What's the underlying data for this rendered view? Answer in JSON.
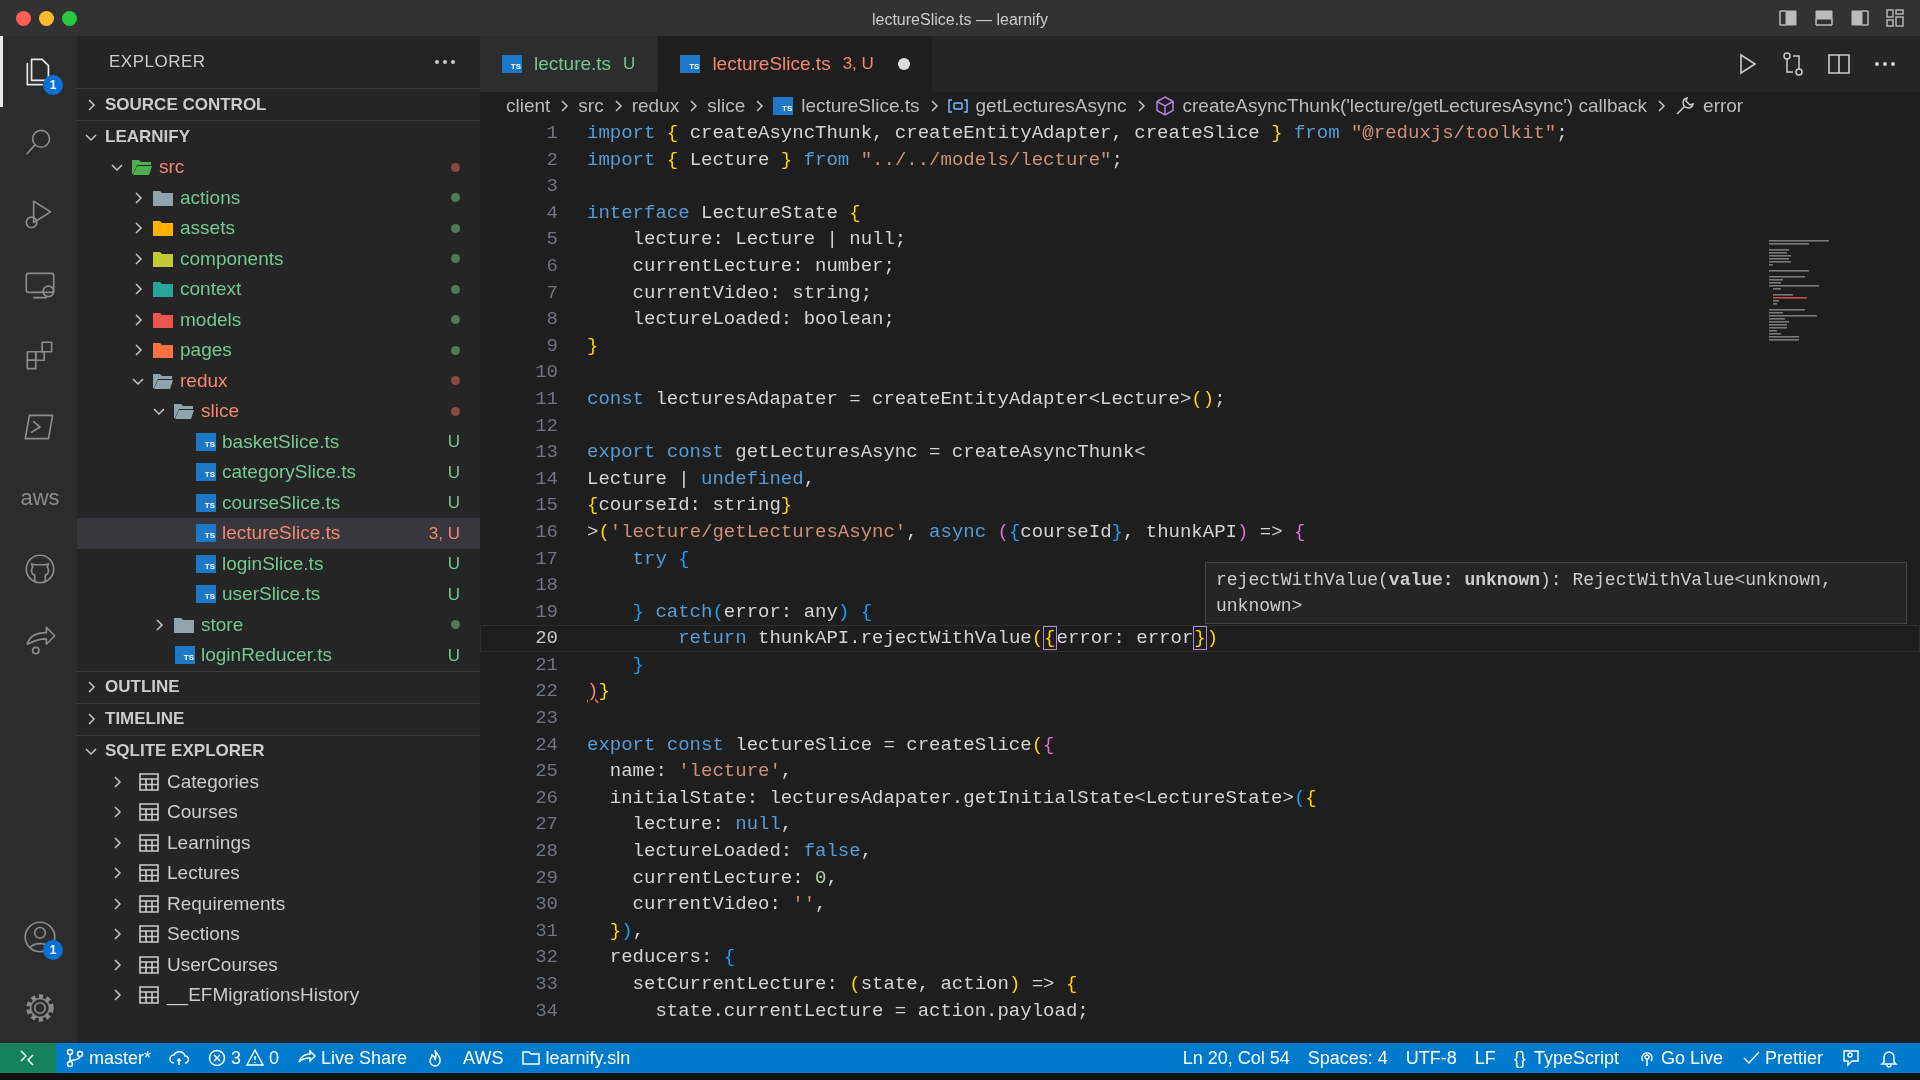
{
  "window": {
    "title": "lectureSlice.ts — learnify"
  },
  "activity_bar": [
    {
      "kind": "files",
      "selected": true,
      "badge": "1"
    },
    {
      "kind": "search",
      "selected": false
    },
    {
      "kind": "debug",
      "selected": false
    },
    {
      "kind": "remote",
      "selected": false
    },
    {
      "kind": "extensions",
      "selected": false
    },
    {
      "kind": "terminal",
      "selected": false
    },
    {
      "kind": "label",
      "selected": false,
      "text": "aws"
    },
    {
      "kind": "github",
      "selected": false
    },
    {
      "kind": "share",
      "selected": false
    }
  ],
  "activity_bottom": [
    {
      "kind": "account",
      "badge": "1"
    },
    {
      "kind": "settings"
    }
  ],
  "sidebar": {
    "title": "EXPLORER",
    "sections": [
      {
        "title": "SOURCE CONTROL",
        "expanded": false
      },
      {
        "title": "LEARNIFY",
        "expanded": true,
        "tree": [
          {
            "label": "src",
            "kind": "folder",
            "expanded": true,
            "color": "#4caf50",
            "error": true,
            "selected": false,
            "children": [
              {
                "label": "actions",
                "kind": "folder",
                "expanded": false,
                "color": "#90a4ae",
                "error": false,
                "selected": false
              },
              {
                "label": "assets",
                "kind": "folder",
                "expanded": false,
                "color": "#ffb300",
                "error": false,
                "selected": false
              },
              {
                "label": "components",
                "kind": "folder",
                "expanded": false,
                "color": "#c0ca33",
                "error": false,
                "selected": false
              },
              {
                "label": "context",
                "kind": "folder",
                "expanded": false,
                "color": "#26a69a",
                "error": false,
                "selected": false
              },
              {
                "label": "models",
                "kind": "folder",
                "expanded": false,
                "color": "#ef5350",
                "error": false,
                "selected": false
              },
              {
                "label": "pages",
                "kind": "folder",
                "expanded": false,
                "color": "#ff7043",
                "error": false,
                "selected": false
              },
              {
                "label": "redux",
                "kind": "folder",
                "expanded": true,
                "color": "#90a4ae",
                "error": true,
                "selected": false,
                "children": [
                  {
                    "label": "slice",
                    "kind": "folder",
                    "expanded": true,
                    "color": "#90a4ae",
                    "error": true,
                    "selected": false,
                    "children": [
                      {
                        "label": "basketSlice.ts",
                        "kind": "file",
                        "badge": "TS",
                        "decoration": "U",
                        "error": false,
                        "selected": false
                      },
                      {
                        "label": "categorySlice.ts",
                        "kind": "file",
                        "badge": "TS",
                        "decoration": "U",
                        "error": false,
                        "selected": false
                      },
                      {
                        "label": "courseSlice.ts",
                        "kind": "file",
                        "badge": "TS",
                        "decoration": "U",
                        "error": false,
                        "selected": false
                      },
                      {
                        "label": "lectureSlice.ts",
                        "kind": "file",
                        "badge": "TS",
                        "decoration": "3, U",
                        "error": true,
                        "selected": true
                      },
                      {
                        "label": "loginSlice.ts",
                        "kind": "file",
                        "badge": "TS",
                        "decoration": "U",
                        "error": false,
                        "selected": false
                      },
                      {
                        "label": "userSlice.ts",
                        "kind": "file",
                        "badge": "TS",
                        "decoration": "U",
                        "error": false,
                        "selected": false
                      }
                    ]
                  },
                  {
                    "label": "store",
                    "kind": "folder",
                    "expanded": false,
                    "color": "#90a4ae",
                    "error": false,
                    "selected": false
                  },
                  {
                    "label": "loginReducer.ts",
                    "kind": "file",
                    "badge": "TS",
                    "decoration": "U",
                    "error": false,
                    "selected": false
                  }
                ]
              }
            ]
          }
        ]
      },
      {
        "title": "OUTLINE",
        "expanded": false
      },
      {
        "title": "TIMELINE",
        "expanded": false
      },
      {
        "title": "SQLITE EXPLORER",
        "expanded": true,
        "tables": [
          "Categories",
          "Courses",
          "Learnings",
          "Lectures",
          "Requirements",
          "Sections",
          "UserCourses",
          "__EFMigrationsHistory"
        ]
      }
    ]
  },
  "tabs": [
    {
      "label": "lecture.ts",
      "badge": "TS",
      "decoration": "U",
      "error": false,
      "selected": false,
      "dirty": false
    },
    {
      "label": "lectureSlice.ts",
      "badge": "TS",
      "decoration": "3, U",
      "error": true,
      "selected": true,
      "dirty": true
    }
  ],
  "breadcrumbs": [
    {
      "kind": "folder",
      "text": "client"
    },
    {
      "kind": "folder",
      "text": "src"
    },
    {
      "kind": "folder",
      "text": "redux"
    },
    {
      "kind": "folder",
      "text": "slice"
    },
    {
      "kind": "file",
      "badge": "TS",
      "text": "lectureSlice.ts"
    },
    {
      "kind": "variable",
      "text": "getLecturesAsync"
    },
    {
      "kind": "function",
      "text": "createAsyncThunk('lecture/getLecturesAsync') callback"
    },
    {
      "kind": "wrench",
      "text": "error"
    }
  ],
  "code": [
    {
      "no": "1",
      "current": false,
      "tokens": [
        {
          "kind": "kw",
          "text": "import"
        },
        {
          "kind": "b1",
          "text": " {"
        },
        {
          "kind": "t",
          "text": " createAsyncThunk, createEntityAdapter, createSlice "
        },
        {
          "kind": "b1",
          "text": "}"
        },
        {
          "kind": "kw",
          "text": " from"
        },
        {
          "kind": "str",
          "text": " \"@reduxjs/toolkit\""
        },
        {
          "kind": "t",
          "text": ";"
        }
      ]
    },
    {
      "no": "2",
      "current": false,
      "tokens": [
        {
          "kind": "kw",
          "text": "import"
        },
        {
          "kind": "b1",
          "text": " {"
        },
        {
          "kind": "t",
          "text": " Lecture "
        },
        {
          "kind": "b1",
          "text": "}"
        },
        {
          "kind": "kw",
          "text": " from"
        },
        {
          "kind": "str",
          "text": " \"../../models/lecture\""
        },
        {
          "kind": "t",
          "text": ";"
        }
      ]
    },
    {
      "no": "3",
      "current": false
    },
    {
      "no": "4",
      "current": false,
      "tokens": [
        {
          "kind": "kw",
          "text": "interface"
        },
        {
          "kind": "t",
          "text": " LectureState "
        },
        {
          "kind": "b1",
          "text": "{"
        }
      ]
    },
    {
      "no": "5",
      "current": false,
      "tokens": [
        {
          "kind": "t",
          "text": "    lecture: Lecture | null;"
        }
      ]
    },
    {
      "no": "6",
      "current": false,
      "tokens": [
        {
          "kind": "t",
          "text": "    currentLecture: number;"
        }
      ]
    },
    {
      "no": "7",
      "current": false,
      "tokens": [
        {
          "kind": "t",
          "text": "    currentVideo: string;"
        }
      ]
    },
    {
      "no": "8",
      "current": false,
      "tokens": [
        {
          "kind": "t",
          "text": "    lectureLoaded: boolean;"
        }
      ]
    },
    {
      "no": "9",
      "current": false,
      "tokens": [
        {
          "kind": "b1",
          "text": "}"
        }
      ]
    },
    {
      "no": "10",
      "current": false
    },
    {
      "no": "11",
      "current": false,
      "tokens": [
        {
          "kind": "kw",
          "text": "const"
        },
        {
          "kind": "t",
          "text": " lecturesAdapater = createEntityAdapter<Lecture>"
        },
        {
          "kind": "b1",
          "text": "()"
        },
        {
          "kind": "t",
          "text": ";"
        }
      ]
    },
    {
      "no": "12",
      "current": false
    },
    {
      "no": "13",
      "current": false,
      "tokens": [
        {
          "kind": "kw",
          "text": "export const"
        },
        {
          "kind": "t",
          "text": " getLecturesAsync = createAsyncThunk<"
        }
      ]
    },
    {
      "no": "14",
      "current": false,
      "tokens": [
        {
          "kind": "t",
          "text": "Lecture | "
        },
        {
          "kind": "kw",
          "text": "undefined"
        },
        {
          "kind": "t",
          "text": ","
        }
      ]
    },
    {
      "no": "15",
      "current": false,
      "tokens": [
        {
          "kind": "b1",
          "text": "{"
        },
        {
          "kind": "t",
          "text": "courseId: string"
        },
        {
          "kind": "b1",
          "text": "}"
        }
      ]
    },
    {
      "no": "16",
      "current": false,
      "tokens": [
        {
          "kind": "t",
          "text": ">"
        },
        {
          "kind": "b1",
          "text": "("
        },
        {
          "kind": "str",
          "text": "'lecture/getLecturesAsync'"
        },
        {
          "kind": "t",
          "text": ", "
        },
        {
          "kind": "kw",
          "text": "async"
        },
        {
          "kind": "b2",
          "text": " ("
        },
        {
          "kind": "b3",
          "text": "{"
        },
        {
          "kind": "t",
          "text": "courseId"
        },
        {
          "kind": "b3",
          "text": "}"
        },
        {
          "kind": "t",
          "text": ", thunkAPI"
        },
        {
          "kind": "b2",
          "text": ")"
        },
        {
          "kind": "t",
          "text": " => "
        },
        {
          "kind": "b2",
          "text": "{"
        }
      ]
    },
    {
      "no": "17",
      "current": false,
      "tokens": [
        {
          "kind": "kw",
          "text": "    try"
        },
        {
          "kind": "b3",
          "text": " {"
        }
      ]
    },
    {
      "no": "18",
      "current": false
    },
    {
      "no": "19",
      "current": false,
      "tokens": [
        {
          "kind": "b3",
          "text": "    }"
        },
        {
          "kind": "kw",
          "text": " catch"
        },
        {
          "kind": "b3",
          "text": "("
        },
        {
          "kind": "t",
          "text": "error: any"
        },
        {
          "kind": "b3",
          "text": ")"
        },
        {
          "kind": "b3",
          "text": " {"
        }
      ]
    },
    {
      "no": "20",
      "current": true,
      "tokens": [
        {
          "kind": "kw",
          "text": "        return"
        },
        {
          "kind": "t",
          "text": " thunkAPI.rejectWithValue"
        },
        {
          "kind": "b1",
          "text": "("
        },
        {
          "kind": "match",
          "text": "{"
        },
        {
          "kind": "t",
          "text": "error: error"
        },
        {
          "kind": "match",
          "text": "}"
        },
        {
          "kind": "b1",
          "text": ")"
        }
      ]
    },
    {
      "no": "21",
      "current": false,
      "tokens": [
        {
          "kind": "b3",
          "text": "    }"
        }
      ]
    },
    {
      "no": "22",
      "current": false,
      "tokens": [
        {
          "kind": "err",
          "text": ")"
        },
        {
          "kind": "b1",
          "text": "}"
        }
      ]
    },
    {
      "no": "23",
      "current": false
    },
    {
      "no": "24",
      "current": false,
      "tokens": [
        {
          "kind": "kw",
          "text": "export const"
        },
        {
          "kind": "t",
          "text": " lectureSlice = createSlice"
        },
        {
          "kind": "b1",
          "text": "("
        },
        {
          "kind": "b2",
          "text": "{"
        }
      ]
    },
    {
      "no": "25",
      "current": false,
      "tokens": [
        {
          "kind": "t",
          "text": "  name: "
        },
        {
          "kind": "str",
          "text": "'lecture'"
        },
        {
          "kind": "t",
          "text": ","
        }
      ]
    },
    {
      "no": "26",
      "current": false,
      "tokens": [
        {
          "kind": "t",
          "text": "  initialState: lecturesAdapater.getInitialState<LectureState>"
        },
        {
          "kind": "b3",
          "text": "("
        },
        {
          "kind": "b1",
          "text": "{"
        }
      ]
    },
    {
      "no": "27",
      "current": false,
      "tokens": [
        {
          "kind": "t",
          "text": "    lecture: "
        },
        {
          "kind": "kw",
          "text": "null"
        },
        {
          "kind": "t",
          "text": ","
        }
      ]
    },
    {
      "no": "28",
      "current": false,
      "tokens": [
        {
          "kind": "t",
          "text": "    lectureLoaded: "
        },
        {
          "kind": "kw",
          "text": "false"
        },
        {
          "kind": "t",
          "text": ","
        }
      ]
    },
    {
      "no": "29",
      "current": false,
      "tokens": [
        {
          "kind": "t",
          "text": "    currentLecture: "
        },
        {
          "kind": "num",
          "text": "0"
        },
        {
          "kind": "t",
          "text": ","
        }
      ]
    },
    {
      "no": "30",
      "current": false,
      "tokens": [
        {
          "kind": "t",
          "text": "    currentVideo: "
        },
        {
          "kind": "str",
          "text": "''"
        },
        {
          "kind": "t",
          "text": ","
        }
      ]
    },
    {
      "no": "31",
      "current": false,
      "tokens": [
        {
          "kind": "b1",
          "text": "  }"
        },
        {
          "kind": "b3",
          "text": ")"
        },
        {
          "kind": "t",
          "text": ","
        }
      ]
    },
    {
      "no": "32",
      "current": false,
      "tokens": [
        {
          "kind": "t",
          "text": "  reducers: "
        },
        {
          "kind": "b3",
          "text": "{"
        }
      ]
    },
    {
      "no": "33",
      "current": false,
      "tokens": [
        {
          "kind": "t",
          "text": "    setCurrentLecture: "
        },
        {
          "kind": "b1",
          "text": "("
        },
        {
          "kind": "t",
          "text": "state, action"
        },
        {
          "kind": "b1",
          "text": ")"
        },
        {
          "kind": "t",
          "text": " => "
        },
        {
          "kind": "b1",
          "text": "{"
        }
      ]
    },
    {
      "no": "34",
      "current": false,
      "tokens": [
        {
          "kind": "t",
          "text": "      state.currentLecture = action.payload;"
        }
      ]
    }
  ],
  "hover": {
    "text": "rejectWithValue(**value: unknown**): RejectWithValue<unknown, unknown>"
  },
  "status_bar": {
    "left": [
      {
        "kind": "remote"
      },
      {
        "kind": "branch",
        "text": "master*"
      },
      {
        "kind": "sync"
      },
      {
        "kind": "problems",
        "errors": "3",
        "warnings": "0"
      },
      {
        "kind": "liveshare",
        "text": "Live Share"
      },
      {
        "kind": "flame"
      },
      {
        "kind": "plain",
        "text": "AWS"
      },
      {
        "kind": "solution",
        "text": "learnify.sln"
      }
    ],
    "right": [
      {
        "kind": "plain",
        "text": "Ln 20, Col 54"
      },
      {
        "kind": "plain",
        "text": "Spaces: 4"
      },
      {
        "kind": "plain",
        "text": "UTF-8"
      },
      {
        "kind": "plain",
        "text": "LF"
      },
      {
        "kind": "language",
        "glyph": "{}",
        "text": "TypeScript"
      },
      {
        "kind": "golive",
        "text": "Go Live"
      },
      {
        "kind": "check",
        "text": "Prettier"
      },
      {
        "kind": "feedback"
      },
      {
        "kind": "bell"
      }
    ]
  }
}
